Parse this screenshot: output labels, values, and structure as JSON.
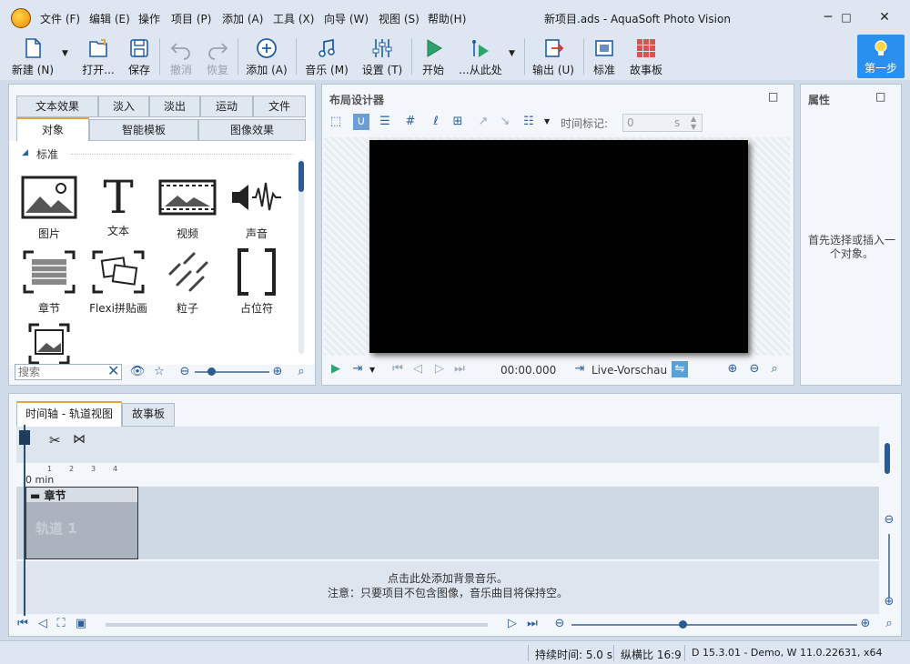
{
  "window": {
    "title": "新项目.ads - AquaSoft Photo Vision",
    "minimize": "─",
    "maximize": "□",
    "close": "✕"
  },
  "menu": [
    "文件 (F)",
    "编辑 (E)",
    "操作",
    "项目 (P)",
    "添加 (A)",
    "工具 (X)",
    "向导 (W)",
    "视图 (S)",
    "帮助(H)"
  ],
  "toolbar": {
    "new": "新建 (N)",
    "open": "打开...",
    "save": "保存",
    "undo": "撤消",
    "redo": "恢复",
    "add": "添加 (A)",
    "music": "音乐 (M)",
    "settings": "设置 (T)",
    "start": "开始",
    "from_here": "...从此处",
    "output": "输出 (U)",
    "standard": "标准",
    "storyboard": "故事板",
    "first_step": "第一步"
  },
  "library": {
    "tabs_row1": [
      "文本效果",
      "淡入",
      "淡出",
      "运动",
      "文件"
    ],
    "tabs_row2": [
      "对象",
      "智能模板",
      "图像效果"
    ],
    "section": "标准",
    "items": [
      "图片",
      "文本",
      "视频",
      "声音",
      "章节",
      "Flexi拼贴画",
      "粒子",
      "占位符"
    ],
    "search_placeholder": "搜索"
  },
  "layout": {
    "title": "布局设计器",
    "time_marker_label": "时间标记:",
    "time_value": "0",
    "time_unit": "s",
    "timecode": "00:00.000",
    "live_preview": "Live-Vorschau"
  },
  "properties": {
    "title": "属性",
    "hint": "首先选择或插入一个对象。"
  },
  "timeline": {
    "tabs": [
      "时间轴 - 轨道视图",
      "故事板"
    ],
    "ruler_start": "0 min",
    "ruler_ticks": [
      "1",
      "2",
      "3",
      "4"
    ],
    "chapter": "章节",
    "track": "轨道 1",
    "music_hint1": "点击此处添加背景音乐。",
    "music_hint2": "注意：只要项目不包含图像，音乐曲目将保持空。"
  },
  "status": {
    "duration": "持续时间: 5.0 s",
    "aspect": "纵横比 16:9",
    "version": "D 15.3.01 - Demo, W 11.0.22631, x64"
  }
}
